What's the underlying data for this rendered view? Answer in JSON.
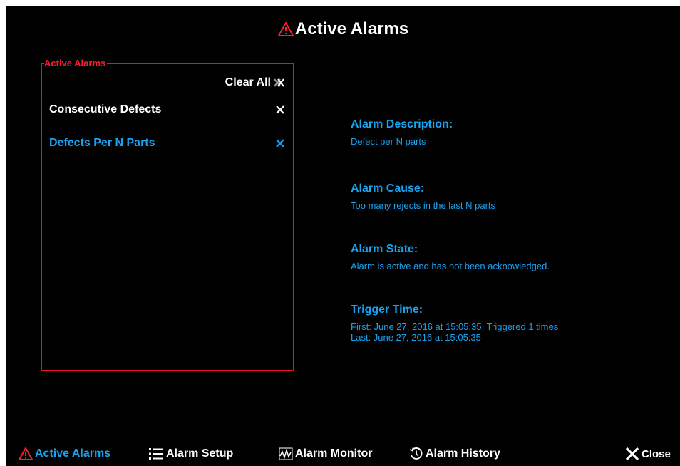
{
  "header": {
    "title": "Active Alarms",
    "icon": "warning-triangle-icon"
  },
  "alarm_list": {
    "legend": "Active Alarms",
    "clear_all_label": "Clear All",
    "items": [
      {
        "label": "Consecutive Defects",
        "selected": false,
        "color": "#ffffff"
      },
      {
        "label": "Defects Per N Parts",
        "selected": true,
        "color": "#1aa2ee"
      }
    ]
  },
  "details": {
    "description_label": "Alarm Description:",
    "description_value": "Defect per N parts",
    "cause_label": "Alarm Cause:",
    "cause_value": "Too many rejects in the last N parts",
    "state_label": "Alarm State:",
    "state_value": "Alarm is active and has not been acknowledged.",
    "trigger_label": "Trigger Time:",
    "trigger_first": "First: June 27, 2016 at 15:05:35,  Triggered 1 times",
    "trigger_last": "Last: June 27, 2016 at 15:05:35"
  },
  "nav": {
    "active_alarms": "Active Alarms",
    "alarm_setup": "Alarm Setup",
    "alarm_monitor": "Alarm Monitor",
    "alarm_history": "Alarm History",
    "close": "Close"
  },
  "colors": {
    "background": "#000000",
    "accent_blue": "#1aa2ee",
    "alert_red": "#e8102a",
    "text_white": "#ffffff"
  }
}
